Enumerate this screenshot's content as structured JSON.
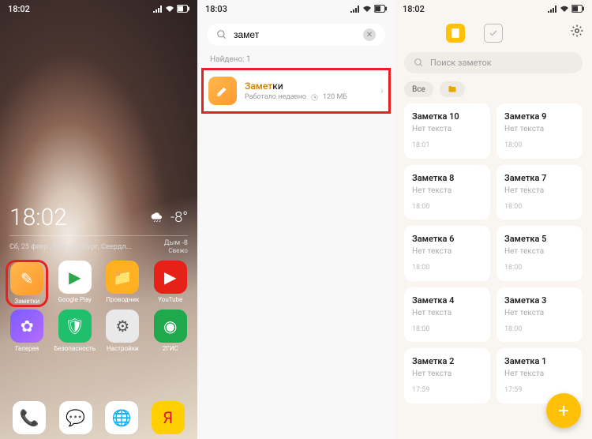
{
  "pane1": {
    "status_time": "18:02",
    "clock": "18:02",
    "temp": "-8°",
    "date_line": "Сб, 25 февр., Екатеринбург, Свердл...",
    "air_label": "Дым -8",
    "air_sub": "Свежо",
    "apps_row1": [
      {
        "label": "Заметки",
        "bg": "linear-gradient(135deg,#ffb84d,#ff9a2e)",
        "glyph": "✎",
        "gc": "#fff",
        "hl": true
      },
      {
        "label": "Google Play",
        "bg": "#fff",
        "glyph": "▶",
        "gc": "#2aa84a"
      },
      {
        "label": "Проводник",
        "bg": "#ffb020",
        "glyph": "📁",
        "gc": "#fff"
      },
      {
        "label": "YouTube",
        "bg": "#e62117",
        "glyph": "▶",
        "gc": "#fff"
      }
    ],
    "apps_row2": [
      {
        "label": "Галерея",
        "bg": "linear-gradient(135deg,#7b5cff,#b56cff)",
        "glyph": "✿",
        "gc": "#fff"
      },
      {
        "label": "Безопасность",
        "bg": "#1fbf6b",
        "glyph": "🛡",
        "gc": "#fff"
      },
      {
        "label": "Настройки",
        "bg": "#e9e9e9",
        "glyph": "⚙",
        "gc": "#555"
      },
      {
        "label": "2ГИС",
        "bg": "#1fa84c",
        "glyph": "◉",
        "gc": "#fff"
      }
    ],
    "dock": [
      {
        "bg": "#fff",
        "glyph": "📞",
        "gc": "#2a7de1"
      },
      {
        "bg": "#fff",
        "glyph": "💬",
        "gc": "#2a7de1"
      },
      {
        "bg": "#fff",
        "glyph": "🌐",
        "gc": "#2a7de1"
      },
      {
        "bg": "#ffcf00",
        "glyph": "Я",
        "gc": "#d13"
      }
    ]
  },
  "pane2": {
    "status_time": "18:03",
    "search_value": "замет",
    "found_label": "Найдено: 1",
    "result": {
      "title_match": "Замет",
      "title_rest": "ки",
      "subtitle": "Работало недавно",
      "size": "120 МБ"
    }
  },
  "pane3": {
    "status_time": "18:02",
    "search_placeholder": "Поиск заметок",
    "filter_all": "Все",
    "notes": [
      {
        "title": "Заметка 10",
        "body": "Нет текста",
        "time": "18:01"
      },
      {
        "title": "Заметка 9",
        "body": "Нет текста",
        "time": "18:00"
      },
      {
        "title": "Заметка 8",
        "body": "Нет текста",
        "time": "18:00"
      },
      {
        "title": "Заметка 7",
        "body": "Нет текста",
        "time": "18:00"
      },
      {
        "title": "Заметка 6",
        "body": "Нет текста",
        "time": "18:00"
      },
      {
        "title": "Заметка 5",
        "body": "Нет текста",
        "time": "18:00"
      },
      {
        "title": "Заметка 4",
        "body": "Нет текста",
        "time": "18:00"
      },
      {
        "title": "Заметка 3",
        "body": "Нет текста",
        "time": "18:00"
      },
      {
        "title": "Заметка 2",
        "body": "Нет текста",
        "time": "17:59"
      },
      {
        "title": "Заметка 1",
        "body": "Нет текста",
        "time": "17:59"
      }
    ]
  }
}
